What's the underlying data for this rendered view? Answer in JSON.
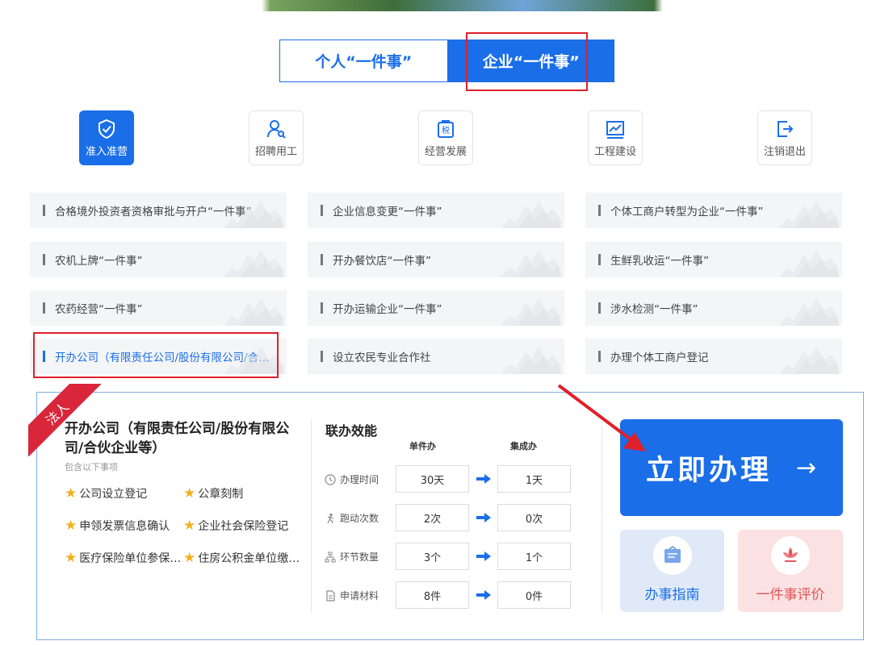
{
  "tabs": [
    {
      "label": "个人“一件事”",
      "active": false
    },
    {
      "label": "企业“一件事”",
      "active": true
    }
  ],
  "categories": [
    {
      "label": "准入准营",
      "icon": "badge-check-icon",
      "active": true
    },
    {
      "label": "招聘用工",
      "icon": "user-search-icon",
      "active": false
    },
    {
      "label": "经营发展",
      "icon": "tax-icon",
      "active": false
    },
    {
      "label": "工程建设",
      "icon": "chart-up-icon",
      "active": false
    },
    {
      "label": "注销退出",
      "icon": "exit-icon",
      "active": false
    }
  ],
  "services": [
    [
      "合格境外投资者资格审批与开户“一件事”",
      "企业信息变更“一件事”",
      "个体工商户转型为企业“一件事”"
    ],
    [
      "农机上牌“一件事”",
      "开办餐饮店“一件事”",
      "生鲜乳收运“一件事”"
    ],
    [
      "农药经营“一件事”",
      "开办运输企业“一件事”",
      "涉水检测“一件事”"
    ],
    [
      "开办公司（有限责任公司/股份有限公司/合…",
      "设立农民专业合作社",
      "办理个体工商户登记"
    ]
  ],
  "detail": {
    "ribbon": "法人",
    "title": "开办公司（有限责任公司/股份有限公司/合伙企业等）",
    "subtitle": "包含以下事项",
    "items": [
      "公司设立登记",
      "公章刻制",
      "申领发票信息确认",
      "企业社会保险登记",
      "医疗保险单位参保…",
      "住房公积金单位缴…"
    ],
    "efficiency": {
      "heading": "联办效能",
      "col_single": "单件办",
      "col_integrated": "集成办",
      "rows": [
        {
          "label": "办理时间",
          "icon": "clock-icon",
          "single": "30天",
          "integrated": "1天"
        },
        {
          "label": "跑动次数",
          "icon": "run-icon",
          "single": "2次",
          "integrated": "0次"
        },
        {
          "label": "环节数量",
          "icon": "flow-icon",
          "single": "3个",
          "integrated": "1个"
        },
        {
          "label": "申请材料",
          "icon": "file-icon",
          "single": "8件",
          "integrated": "0件"
        }
      ]
    }
  },
  "actions": {
    "apply": "立即办理",
    "apply_arrow": "→",
    "guide": "办事指南",
    "rate": "一件事评价"
  },
  "colors": {
    "primary": "#1a6ee8",
    "highlight": "#e0202a",
    "ribbon": "#d9263a"
  }
}
